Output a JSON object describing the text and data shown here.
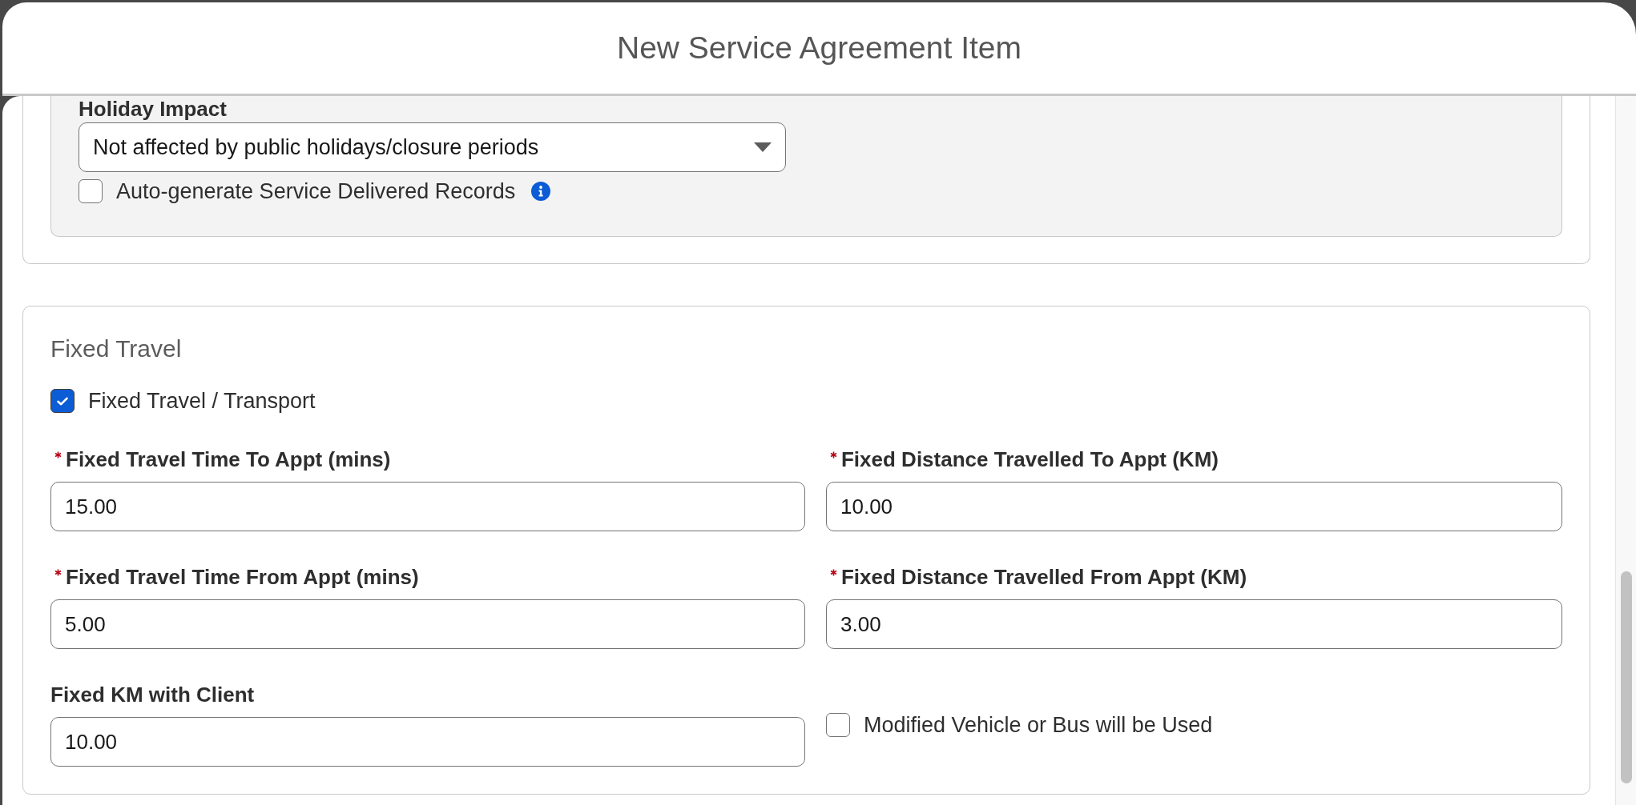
{
  "dialog": {
    "title": "New Service Agreement Item"
  },
  "sections": [
    {
      "kind": "panel",
      "rows": [
        [
          {
            "kind": "select",
            "label": "Holiday Impact",
            "required": false,
            "value": "Not affected by public holidays/closure periods"
          }
        ],
        [
          {
            "kind": "checkbox",
            "label": "Auto-generate Service Delivered Records",
            "checked": false,
            "info": true
          }
        ]
      ]
    },
    {
      "kind": "card",
      "title": "Fixed Travel",
      "rows": [
        [
          {
            "kind": "checkbox",
            "label": "Fixed Travel / Transport",
            "checked": true,
            "info": false
          }
        ],
        [
          {
            "kind": "text",
            "label": "Fixed Travel Time To Appt (mins)",
            "required": true,
            "value": "15.00"
          },
          {
            "kind": "text",
            "label": "Fixed Distance Travelled To Appt (KM)",
            "required": true,
            "value": "10.00"
          }
        ],
        [
          {
            "kind": "text",
            "label": "Fixed Travel Time From Appt (mins)",
            "required": true,
            "value": "5.00"
          },
          {
            "kind": "text",
            "label": "Fixed Distance Travelled From Appt (KM)",
            "required": true,
            "value": "3.00"
          }
        ],
        [
          {
            "kind": "text",
            "label": "Fixed KM with Client",
            "required": false,
            "value": "10.00"
          },
          {
            "kind": "checkbox",
            "label": "Modified Vehicle or Bus will be Used",
            "checked": false,
            "info": false
          }
        ]
      ]
    }
  ]
}
